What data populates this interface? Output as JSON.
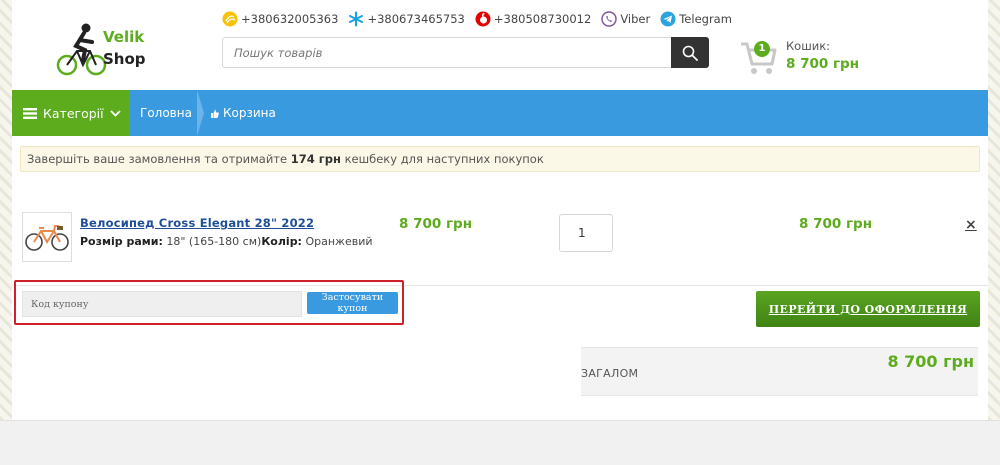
{
  "header": {
    "logo": {
      "line1": "Velik",
      "line2": "Shop"
    },
    "contacts": [
      {
        "icon": "lifecell-icon",
        "text": "+380632005363"
      },
      {
        "icon": "kyivstar-icon",
        "text": "+380673465753"
      },
      {
        "icon": "vodafone-icon",
        "text": "+380508730012"
      },
      {
        "icon": "viber-icon",
        "text": "Viber"
      },
      {
        "icon": "telegram-icon",
        "text": "Telegram"
      }
    ],
    "search": {
      "placeholder": "Пошук товарів"
    },
    "cart": {
      "count": "1",
      "label": "Кошик:",
      "total": "8 700 грн"
    }
  },
  "nav": {
    "categories_label": "Категорії",
    "breadcrumbs": [
      "Головна",
      "Корзина"
    ]
  },
  "notice": {
    "prefix": "Завершіть ваше замовлення та отримайте ",
    "amount": "174 грн",
    "suffix": " кешбеку для наступних покупок"
  },
  "item": {
    "name": "Велосипед Cross Elegant 28\" 2022",
    "frame_label": "Розмір рами:",
    "frame_value": " 18\" (165-180 см)",
    "color_label": "Колір:",
    "color_value": " Оранжевий",
    "price": "8 700 грн",
    "quantity": "1",
    "subtotal": "8 700 грн",
    "remove": "×"
  },
  "coupon": {
    "placeholder": "Код купону",
    "button": "Застосувати купон"
  },
  "checkout": {
    "button": "ПЕРЕЙТИ ДО ОФОРМЛЕННЯ"
  },
  "total": {
    "label": "ЗАГАЛОМ",
    "value": "8 700 грн"
  },
  "colors": {
    "green": "#5cac1e",
    "blue": "#3a9ae0",
    "dark_green": "#3f8414",
    "highlight": "#d0212b"
  }
}
